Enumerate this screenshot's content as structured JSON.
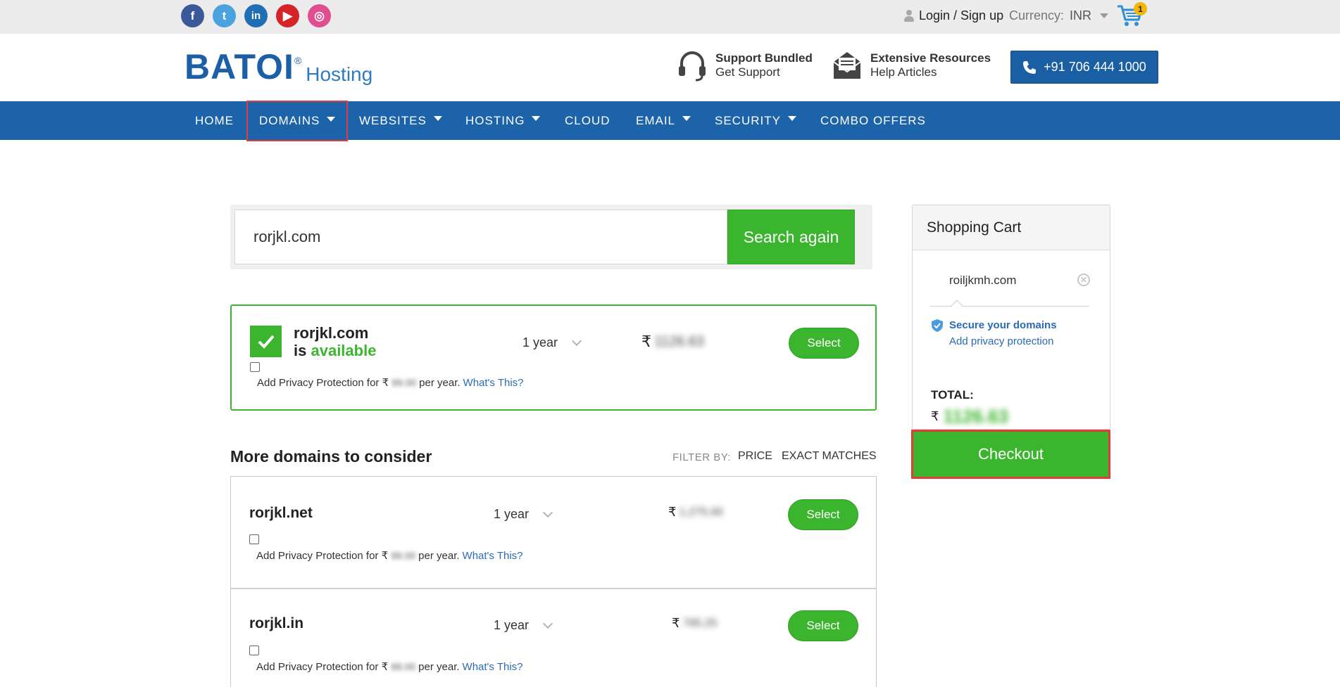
{
  "topbar": {
    "social": [
      {
        "name": "facebook",
        "glyph": "f",
        "color": "#3b5998"
      },
      {
        "name": "twitter",
        "glyph": "t",
        "color": "#4aa3df"
      },
      {
        "name": "linkedin",
        "glyph": "in",
        "color": "#1f6fb2"
      },
      {
        "name": "youtube",
        "glyph": "▶",
        "color": "#d42428"
      },
      {
        "name": "instagram",
        "glyph": "◎",
        "color": "#e04e8f"
      }
    ],
    "login_label": "Login / Sign up",
    "currency_label": "Currency:",
    "currency_value": "INR",
    "cart_count": "1"
  },
  "header": {
    "logo_text": "BATOI",
    "logo_sub": "Hosting",
    "support_title": "Support Bundled",
    "support_sub": "Get Support",
    "resources_title": "Extensive Resources",
    "resources_sub": "Help Articles",
    "phone": "+91 706 444 1000"
  },
  "nav": {
    "items": [
      {
        "label": "HOME",
        "dropdown": false
      },
      {
        "label": "DOMAINS",
        "dropdown": true,
        "active": true
      },
      {
        "label": "WEBSITES",
        "dropdown": true
      },
      {
        "label": "HOSTING",
        "dropdown": true
      },
      {
        "label": "CLOUD",
        "dropdown": false
      },
      {
        "label": "EMAIL",
        "dropdown": true
      },
      {
        "label": "SECURITY",
        "dropdown": true
      },
      {
        "label": "COMBO OFFERS",
        "dropdown": false
      }
    ]
  },
  "search": {
    "value": "rorjkl.com",
    "button_label": "Search again"
  },
  "result": {
    "domain": "rorjkl.com",
    "is_label": "is",
    "status": "available",
    "period": "1 year",
    "currency_symbol": "₹",
    "price": "1126.63",
    "select_label": "Select",
    "privacy_prefix": "Add Privacy Protection for ₹",
    "privacy_price": "99.00",
    "privacy_suffix": "per year.",
    "privacy_link": "What's This?"
  },
  "more": {
    "title": "More domains to consider",
    "filter_label": "FILTER BY:",
    "filter_price": "PRICE",
    "filter_exact": "EXACT MATCHES",
    "rows": [
      {
        "domain": "rorjkl.net",
        "period": "1 year",
        "currency_symbol": "₹",
        "price": "1,275.00",
        "select_label": "Select",
        "privacy_prefix": "Add Privacy Protection for ₹",
        "privacy_price": "99.00",
        "privacy_suffix": "per year.",
        "privacy_link": "What's This?"
      },
      {
        "domain": "rorjkl.in",
        "period": "1 year",
        "currency_symbol": "₹",
        "price": "795.25",
        "select_label": "Select",
        "privacy_prefix": "Add Privacy Protection for ₹",
        "privacy_price": "99.00",
        "privacy_suffix": "per year.",
        "privacy_link": "What's This?"
      }
    ]
  },
  "cart": {
    "title": "Shopping Cart",
    "item": "roiljkmh.com",
    "secure_label": "Secure your domains",
    "add_privacy_label": "Add privacy protection",
    "total_label": "TOTAL:",
    "currency_symbol": "₹",
    "total_value": "1126.63",
    "checkout_label": "Checkout"
  },
  "colors": {
    "brand_blue": "#1c63aa",
    "accent_green": "#3cb52e",
    "highlight_red": "#e23b3b",
    "link_blue": "#2a6bb5"
  }
}
